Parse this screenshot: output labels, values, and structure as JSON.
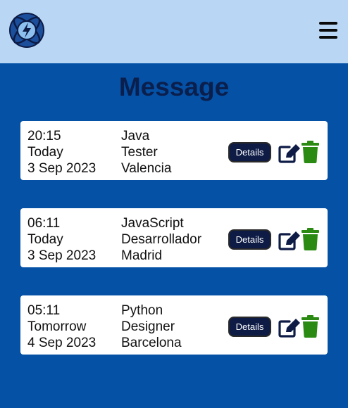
{
  "header": {
    "logo_icon": "atom-lightning-logo-icon",
    "menu_icon": "hamburger-menu-icon",
    "background": "#b9d7f4"
  },
  "page": {
    "title": "Message",
    "background": "#0451a5"
  },
  "messages": [
    {
      "time": "20:15",
      "day": "Today",
      "date": "3 Sep 2023",
      "language": "Java",
      "role": "Tester",
      "city": "Valencia",
      "details_label": "Details"
    },
    {
      "time": "06:11",
      "day": "Today",
      "date": "3 Sep 2023",
      "language": "JavaScript",
      "role": "Desarrollador",
      "city": "Madrid",
      "details_label": "Details"
    },
    {
      "time": "05:11",
      "day": "Tomorrow",
      "date": "4 Sep 2023",
      "language": "Python",
      "role": "Designer",
      "city": "Barcelona",
      "details_label": "Details"
    }
  ],
  "colors": {
    "edit_icon": "#0d1b45",
    "delete_icon": "#2a8a12",
    "details_button": "#0d1b45"
  }
}
